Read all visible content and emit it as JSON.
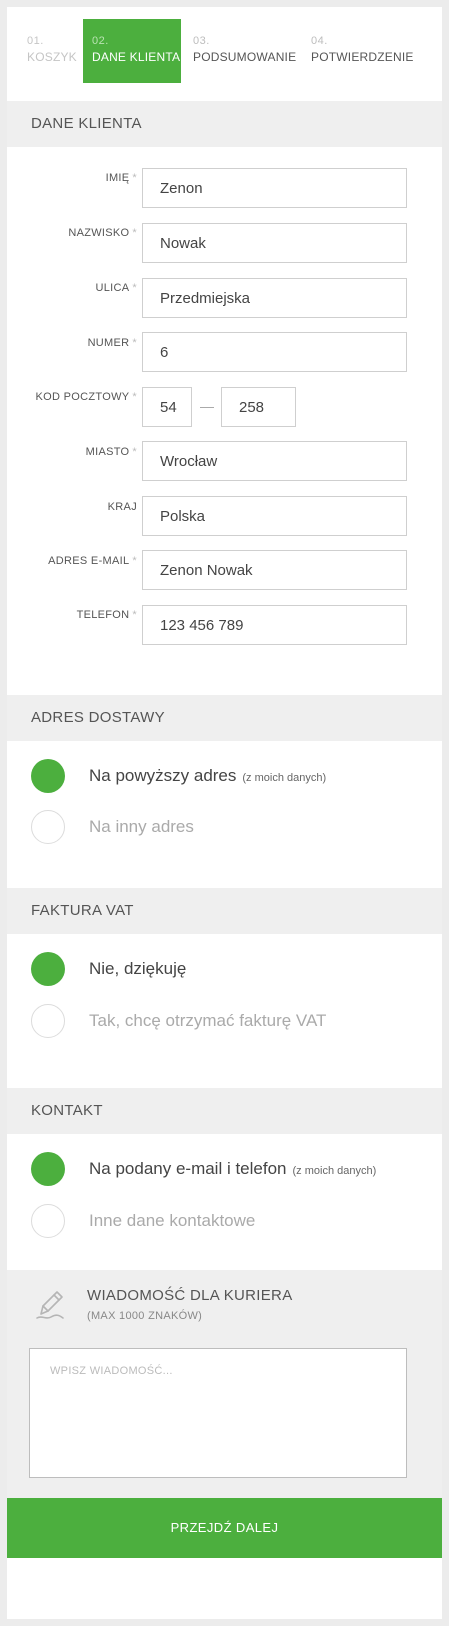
{
  "steps": [
    {
      "num": "01.",
      "label": "KOSZYK"
    },
    {
      "num": "02.",
      "label": "DANE KLIENTA"
    },
    {
      "num": "03.",
      "label": "PODSUMOWANIE"
    },
    {
      "num": "04.",
      "label": "POTWIERDZENIE"
    }
  ],
  "customer": {
    "heading": "DANE KLIENTA",
    "required_mark": "*",
    "fields": {
      "first_name": {
        "label": "IMIĘ",
        "value": "Zenon"
      },
      "last_name": {
        "label": "NAZWISKO",
        "value": "Nowak"
      },
      "street": {
        "label": "ULICA",
        "value": "Przedmiejska"
      },
      "number": {
        "label": "NUMER",
        "value": "6"
      },
      "postal": {
        "label": "KOD POCZTOWY",
        "part1": "54",
        "part2": "258"
      },
      "city": {
        "label": "MIASTO",
        "value": "Wrocław"
      },
      "country": {
        "label": "KRAJ",
        "value": "Polska"
      },
      "email": {
        "label": "ADRES E-MAIL",
        "value": "Zenon Nowak"
      },
      "phone": {
        "label": "TELEFON",
        "value": "123 456 789"
      }
    }
  },
  "delivery": {
    "heading": "ADRES DOSTAWY",
    "options": [
      {
        "label": "Na powyższy adres",
        "note": "(z moich danych)",
        "selected": true
      },
      {
        "label": "Na inny adres",
        "note": "",
        "selected": false
      }
    ]
  },
  "invoice": {
    "heading": "FAKTURA VAT",
    "options": [
      {
        "label": "Nie, dziękuję",
        "selected": true
      },
      {
        "label": "Tak, chcę otrzymać fakturę VAT",
        "selected": false
      }
    ]
  },
  "contact": {
    "heading": "KONTAKT",
    "options": [
      {
        "label": "Na podany e-mail i telefon",
        "note": "(z moich danych)",
        "selected": true
      },
      {
        "label": "Inne dane kontaktowe",
        "note": "",
        "selected": false
      }
    ]
  },
  "courier": {
    "title": "WIADOMOŚĆ DLA KURIERA",
    "subtitle": "(MAX 1000 ZNAKÓW)",
    "placeholder": "WPISZ WIADOMOŚĆ...",
    "icon": "pen-icon"
  },
  "next_button": "PRZEJDŹ DALEJ",
  "colors": {
    "accent": "#4caf3e",
    "section_bg": "#efefef"
  }
}
